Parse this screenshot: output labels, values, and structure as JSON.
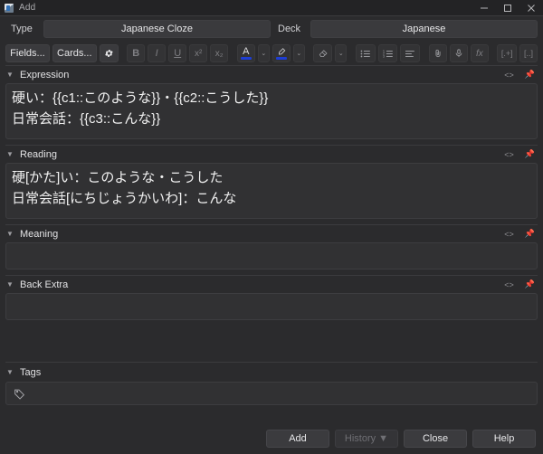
{
  "window": {
    "title": "Add",
    "icon": "anki-icon",
    "controls": {
      "minimize": "–",
      "maximize": "□",
      "close": "✕"
    }
  },
  "notetype_row": {
    "type_label": "Type",
    "type_value": "Japanese Cloze",
    "deck_label": "Deck",
    "deck_value": "Japanese"
  },
  "toolbar": {
    "fields_label": "Fields...",
    "cards_label": "Cards...",
    "settings_icon": "gear-icon",
    "bold_label": "B",
    "italic_label": "I",
    "underline_label": "U",
    "superscript_label": "x²",
    "subscript_label": "x₂",
    "text_color_label": "A",
    "text_color_swatch": "#1e3ed4",
    "text_color_caret": "⌄",
    "highlight_icon": "marker-icon",
    "highlight_swatch": "#1e3ed4",
    "highlight_caret": "⌄",
    "remove_format_icon": "eraser-icon",
    "remove_format_caret": "⌄",
    "unordered_list_icon": "bullet-list-icon",
    "ordered_list_icon": "numbered-list-icon",
    "justify_icon": "text-align-icon",
    "attach_icon": "paperclip-icon",
    "record_icon": "microphone-icon",
    "equation_label": "fx",
    "cloze_new_label": "[.+]",
    "cloze_same_label": "[..]"
  },
  "fields": [
    {
      "name": "Expression",
      "value": "硬い：{{c1::このような}}・{{c2::こうした}}\n日常会話：{{c3::こんな}}",
      "collapse_icon": "chevron-down-icon",
      "html_icon": "<>",
      "pin_icon": "pin-icon"
    },
    {
      "name": "Reading",
      "value": "硬[かた]い：このような・こうした\n日常会話[にちじょうかいわ]：こんな",
      "collapse_icon": "chevron-down-icon",
      "html_icon": "<>",
      "pin_icon": "pin-icon"
    },
    {
      "name": "Meaning",
      "value": "",
      "collapse_icon": "chevron-down-icon",
      "html_icon": "<>",
      "pin_icon": "pin-icon"
    },
    {
      "name": "Back Extra",
      "value": "",
      "collapse_icon": "chevron-down-icon",
      "html_icon": "<>",
      "pin_icon": "pin-icon"
    }
  ],
  "tags": {
    "label": "Tags",
    "collapse_icon": "chevron-down-icon",
    "tag_icon": "tag-icon",
    "value": ""
  },
  "footer": {
    "add_label": "Add",
    "history_label": "History ▼",
    "history_disabled": true,
    "close_label": "Close",
    "help_label": "Help"
  }
}
